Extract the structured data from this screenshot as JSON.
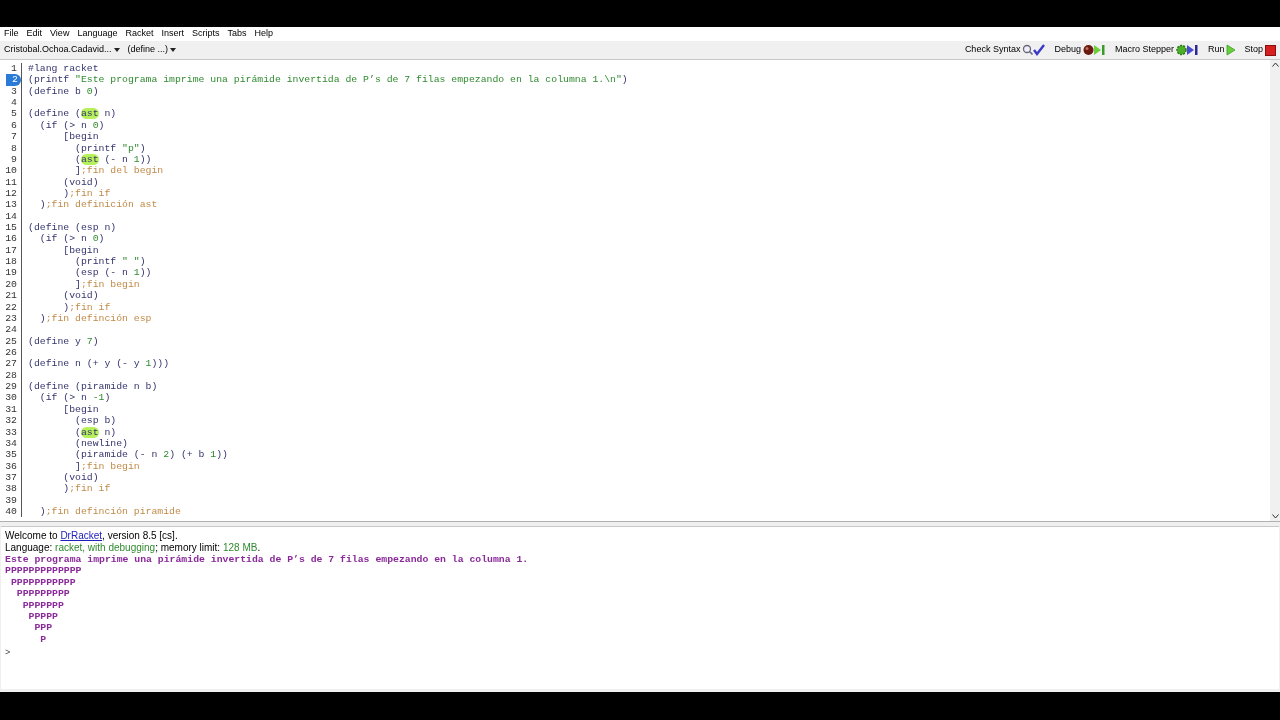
{
  "menu": [
    "File",
    "Edit",
    "View",
    "Language",
    "Racket",
    "Insert",
    "Scripts",
    "Tabs",
    "Help"
  ],
  "toolbar": {
    "file_selector": "Cristobal.Ochoa.Cadavid...",
    "definitions_selector": "(define ...)",
    "buttons": [
      {
        "label": "Check Syntax",
        "kind": "check"
      },
      {
        "label": "Debug",
        "kind": "debug"
      },
      {
        "label": "Macro Stepper",
        "kind": "stepper"
      },
      {
        "label": "Run",
        "kind": "run"
      },
      {
        "label": "Stop",
        "kind": "stop"
      }
    ]
  },
  "editor": {
    "lines": [
      {
        "number": "1",
        "selected": false,
        "tokens": [
          {
            "text": "#lang racket",
            "kind": "plain"
          }
        ]
      },
      {
        "number": "2",
        "selected": true,
        "tokens": [
          {
            "text": "(printf ",
            "kind": "plain"
          },
          {
            "text": "\"Este programa imprime una pirámide invertida de P’s de 7 filas empezando en la columna 1.\\n\"",
            "kind": "string"
          },
          {
            "text": ")",
            "kind": "plain"
          }
        ]
      },
      {
        "number": "3",
        "selected": false,
        "tokens": [
          {
            "text": "(define b ",
            "kind": "plain"
          },
          {
            "text": "0",
            "kind": "constant"
          },
          {
            "text": ")",
            "kind": "plain"
          }
        ]
      },
      {
        "number": "4",
        "selected": false
      },
      {
        "number": "5",
        "selected": false,
        "tokens": [
          {
            "text": "(define (",
            "kind": "plain"
          },
          {
            "text": "ast",
            "kind": "highlight"
          },
          {
            "text": " n)",
            "kind": "plain"
          }
        ]
      },
      {
        "number": "6",
        "selected": false,
        "tokens": [
          {
            "text": "  (if (> n ",
            "kind": "plain"
          },
          {
            "text": "0",
            "kind": "constant"
          },
          {
            "text": ")",
            "kind": "plain"
          }
        ]
      },
      {
        "number": "7",
        "selected": false,
        "tokens": [
          {
            "text": "      [begin",
            "kind": "plain"
          }
        ]
      },
      {
        "number": "8",
        "selected": false,
        "tokens": [
          {
            "text": "        (printf ",
            "kind": "plain"
          },
          {
            "text": "\"p\"",
            "kind": "string"
          },
          {
            "text": ")",
            "kind": "plain"
          }
        ]
      },
      {
        "number": "9",
        "selected": false,
        "tokens": [
          {
            "text": "        (",
            "kind": "plain"
          },
          {
            "text": "ast",
            "kind": "highlight"
          },
          {
            "text": " (- n ",
            "kind": "plain"
          },
          {
            "text": "1",
            "kind": "constant"
          },
          {
            "text": "))",
            "kind": "plain"
          }
        ]
      },
      {
        "number": "10",
        "selected": false,
        "tokens": [
          {
            "text": "        ]",
            "kind": "plain"
          },
          {
            "text": ";fin del begin",
            "kind": "comment"
          }
        ]
      },
      {
        "number": "11",
        "selected": false,
        "tokens": [
          {
            "text": "      (void)",
            "kind": "plain"
          }
        ]
      },
      {
        "number": "12",
        "selected": false,
        "tokens": [
          {
            "text": "      )",
            "kind": "plain"
          },
          {
            "text": ";fin if",
            "kind": "comment"
          }
        ]
      },
      {
        "number": "13",
        "selected": false,
        "tokens": [
          {
            "text": "  )",
            "kind": "plain"
          },
          {
            "text": ";fin definición ast",
            "kind": "comment"
          }
        ]
      },
      {
        "number": "14",
        "selected": false
      },
      {
        "number": "15",
        "selected": false,
        "tokens": [
          {
            "text": "(define (esp n)",
            "kind": "plain"
          }
        ]
      },
      {
        "number": "16",
        "selected": false,
        "tokens": [
          {
            "text": "  (if (> n ",
            "kind": "plain"
          },
          {
            "text": "0",
            "kind": "constant"
          },
          {
            "text": ")",
            "kind": "plain"
          }
        ]
      },
      {
        "number": "17",
        "selected": false,
        "tokens": [
          {
            "text": "      [begin",
            "kind": "plain"
          }
        ]
      },
      {
        "number": "18",
        "selected": false,
        "tokens": [
          {
            "text": "        (printf ",
            "kind": "plain"
          },
          {
            "text": "\" \"",
            "kind": "string"
          },
          {
            "text": ")",
            "kind": "plain"
          }
        ]
      },
      {
        "number": "19",
        "selected": false,
        "tokens": [
          {
            "text": "        (esp (- n ",
            "kind": "plain"
          },
          {
            "text": "1",
            "kind": "constant"
          },
          {
            "text": "))",
            "kind": "plain"
          }
        ]
      },
      {
        "number": "20",
        "selected": false,
        "tokens": [
          {
            "text": "        ]",
            "kind": "plain"
          },
          {
            "text": ";fin begin",
            "kind": "comment"
          }
        ]
      },
      {
        "number": "21",
        "selected": false,
        "tokens": [
          {
            "text": "      (void)",
            "kind": "plain"
          }
        ]
      },
      {
        "number": "22",
        "selected": false,
        "tokens": [
          {
            "text": "      )",
            "kind": "plain"
          },
          {
            "text": ";fin if",
            "kind": "comment"
          }
        ]
      },
      {
        "number": "23",
        "selected": false,
        "tokens": [
          {
            "text": "  )",
            "kind": "plain"
          },
          {
            "text": ";fin definción esp",
            "kind": "comment"
          }
        ]
      },
      {
        "number": "24",
        "selected": false
      },
      {
        "number": "25",
        "selected": false,
        "tokens": [
          {
            "text": "(define y ",
            "kind": "plain"
          },
          {
            "text": "7",
            "kind": "constant"
          },
          {
            "text": ")",
            "kind": "plain"
          }
        ]
      },
      {
        "number": "26",
        "selected": false
      },
      {
        "number": "27",
        "selected": false,
        "tokens": [
          {
            "text": "(define n (+ y (- y ",
            "kind": "plain"
          },
          {
            "text": "1",
            "kind": "constant"
          },
          {
            "text": ")))",
            "kind": "plain"
          }
        ]
      },
      {
        "number": "28",
        "selected": false
      },
      {
        "number": "29",
        "selected": false,
        "tokens": [
          {
            "text": "(define (piramide n b)",
            "kind": "plain"
          }
        ]
      },
      {
        "number": "30",
        "selected": false,
        "tokens": [
          {
            "text": "  (if (> n ",
            "kind": "plain"
          },
          {
            "text": "-1",
            "kind": "constant"
          },
          {
            "text": ")",
            "kind": "plain"
          }
        ]
      },
      {
        "number": "31",
        "selected": false,
        "tokens": [
          {
            "text": "      [begin",
            "kind": "plain"
          }
        ]
      },
      {
        "number": "32",
        "selected": false,
        "tokens": [
          {
            "text": "        (esp b)",
            "kind": "plain"
          }
        ]
      },
      {
        "number": "33",
        "selected": false,
        "tokens": [
          {
            "text": "        (",
            "kind": "plain"
          },
          {
            "text": "ast",
            "kind": "highlight"
          },
          {
            "text": " n)",
            "kind": "plain"
          }
        ]
      },
      {
        "number": "34",
        "selected": false,
        "tokens": [
          {
            "text": "        (newline)",
            "kind": "plain"
          }
        ]
      },
      {
        "number": "35",
        "selected": false,
        "tokens": [
          {
            "text": "        (piramide (- n ",
            "kind": "plain"
          },
          {
            "text": "2",
            "kind": "constant"
          },
          {
            "text": ") (+ b ",
            "kind": "plain"
          },
          {
            "text": "1",
            "kind": "constant"
          },
          {
            "text": "))",
            "kind": "plain"
          }
        ]
      },
      {
        "number": "36",
        "selected": false,
        "tokens": [
          {
            "text": "        ]",
            "kind": "plain"
          },
          {
            "text": ";fin begin",
            "kind": "comment"
          }
        ]
      },
      {
        "number": "37",
        "selected": false,
        "tokens": [
          {
            "text": "      (void)",
            "kind": "plain"
          }
        ]
      },
      {
        "number": "38",
        "selected": false,
        "tokens": [
          {
            "text": "      )",
            "kind": "plain"
          },
          {
            "text": ";fin if",
            "kind": "comment"
          }
        ]
      },
      {
        "number": "39",
        "selected": false
      },
      {
        "number": "40",
        "selected": false,
        "tokens": [
          {
            "text": "  )",
            "kind": "plain"
          },
          {
            "text": ";fin definción piramide",
            "kind": "comment"
          }
        ]
      }
    ]
  },
  "interactions": {
    "welcome": [
      {
        "text": "Welcome to ",
        "kind": "plain"
      },
      {
        "text": "DrRacket",
        "kind": "link"
      },
      {
        "text": ", version 8.5 [cs].",
        "kind": "plain"
      }
    ],
    "language": [
      {
        "text": "Language: ",
        "kind": "plain"
      },
      {
        "text": "racket, with debugging",
        "kind": "value"
      },
      {
        "text": "; memory limit: ",
        "kind": "plain"
      },
      {
        "text": "128 MB",
        "kind": "value"
      },
      {
        "text": ".",
        "kind": "plain"
      }
    ],
    "output": [
      "Este programa imprime una pirámide invertida de P’s de 7 filas empezando en la columna 1.",
      "PPPPPPPPPPPPP",
      " PPPPPPPPPPP",
      "  PPPPPPPPP",
      "   PPPPPPP",
      "    PPPPP",
      "     PPP",
      "      P"
    ],
    "prompt": ">"
  }
}
